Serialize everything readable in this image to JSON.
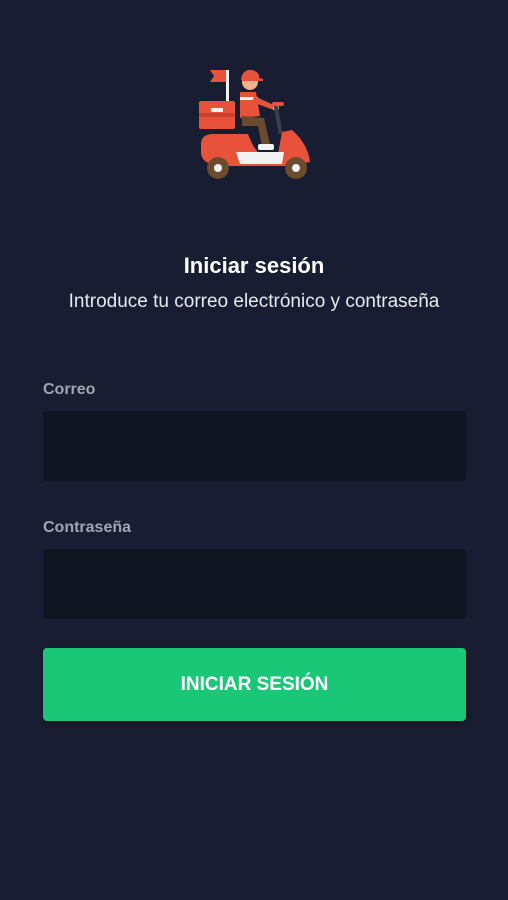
{
  "header": {
    "logo_icon": "delivery-scooter-icon",
    "title": "Iniciar sesión",
    "subtitle": "Introduce tu correo electrónico y contraseña"
  },
  "form": {
    "email": {
      "label": "Correo",
      "value": "",
      "placeholder": ""
    },
    "password": {
      "label": "Contraseña",
      "value": "",
      "placeholder": ""
    },
    "submit_label": "INICIAR SESIÓN"
  },
  "colors": {
    "background": "#181d31",
    "input_background": "#111522",
    "accent": "#1ac777",
    "logo_red": "#e8523a"
  }
}
